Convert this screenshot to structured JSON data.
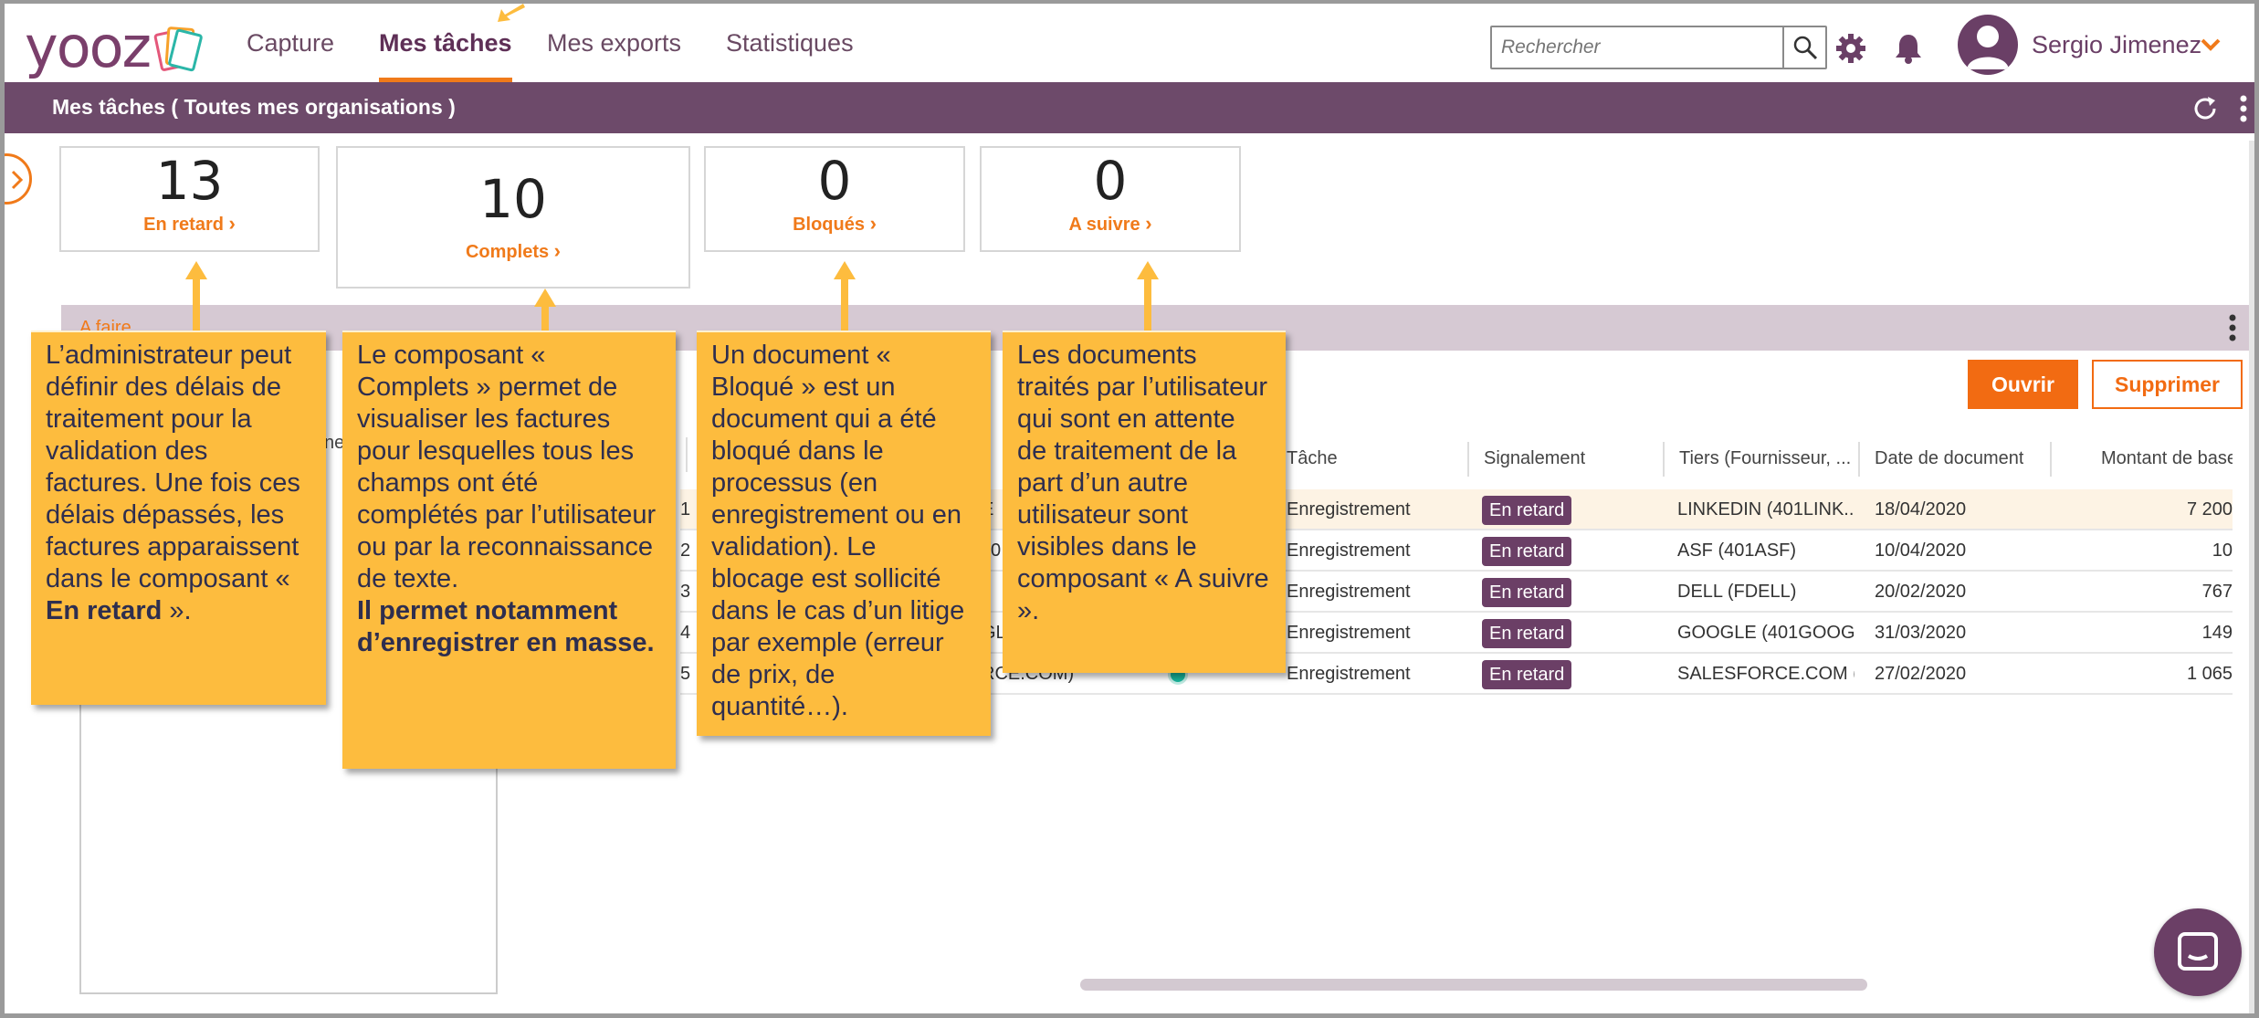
{
  "nav": {
    "logo": "yooz",
    "tabs": [
      "Capture",
      "Mes tâches",
      "Mes exports",
      "Statistiques"
    ],
    "active_tab": "Mes tâches",
    "search_placeholder": "Rechercher",
    "user_name": "Sergio Jimenez"
  },
  "header": {
    "title": "Mes tâches ( Toutes mes organisations )"
  },
  "counters": [
    {
      "value": "13",
      "label": "En retard"
    },
    {
      "value": "10",
      "label": "Complets"
    },
    {
      "value": "0",
      "label": "Bloqués"
    },
    {
      "value": "0",
      "label": "A suivre"
    }
  ],
  "section": {
    "label": "A faire"
  },
  "actions": {
    "open_label": "Ouvrir",
    "delete_label": "Supprimer"
  },
  "table": {
    "columns": [
      "Tâche",
      "Signalement",
      "Tiers (Fournisseur, ...",
      "Date de document",
      "Montant de base"
    ],
    "rows": [
      {
        "idx": "1",
        "frag": "E",
        "task": "Enregistrement",
        "flag": "En retard",
        "tiers": "LINKEDIN (401LINK...",
        "date": "18/04/2020",
        "amount": "7 200"
      },
      {
        "idx": "2",
        "frag": "0",
        "task": "Enregistrement",
        "flag": "En retard",
        "tiers": "ASF (401ASF)",
        "date": "10/04/2020",
        "amount": "10"
      },
      {
        "idx": "3",
        "frag": "",
        "task": "Enregistrement",
        "flag": "En retard",
        "tiers": "DELL (FDELL)",
        "date": "20/02/2020",
        "amount": "767"
      },
      {
        "idx": "4",
        "frag": "GL",
        "task": "Enregistrement",
        "flag": "En retard",
        "tiers": "GOOGLE (401GOOG...",
        "date": "31/03/2020",
        "amount": "149"
      },
      {
        "idx": "5",
        "frag": "RCE.COM)",
        "task": "Enregistrement",
        "flag": "En retard",
        "tiers": "SALESFORCE.COM (...",
        "date": "27/02/2020",
        "amount": "1 065"
      }
    ],
    "left_fragment": "ne"
  },
  "callouts": {
    "c1": {
      "text": "L’administrateur peut définir des délais de traitement pour la validation des factures. Une fois ces délais dépassés, les factures apparaissent dans le composant « ",
      "bold": "En retard",
      "tail": " »."
    },
    "c2": {
      "text": "Le composant « Complets » permet de visualiser les factures pour lesquelles tous les champs ont été complétés par l’utilisateur ou par la reconnaissance de texte.",
      "bold": "Il permet notamment d’enregistrer en masse."
    },
    "c3": {
      "text": "Un document « Bloqué » est un document qui a été bloqué dans le processus (en enregistrement ou en validation). Le blocage est sollicité dans le cas d’un litige par exemple (erreur de prix, de quantité…)."
    },
    "c4": {
      "text": "Les documents traités par l’utilisateur qui sont en attente de traitement de la part d’un autre utilisateur sont visibles dans le composant « A suivre »."
    }
  },
  "colors": {
    "brand_purple": "#6d4a6a",
    "accent_orange": "#f07a1a",
    "callout_yellow": "#fdbc3e",
    "badge_purple": "#6b3f66"
  }
}
